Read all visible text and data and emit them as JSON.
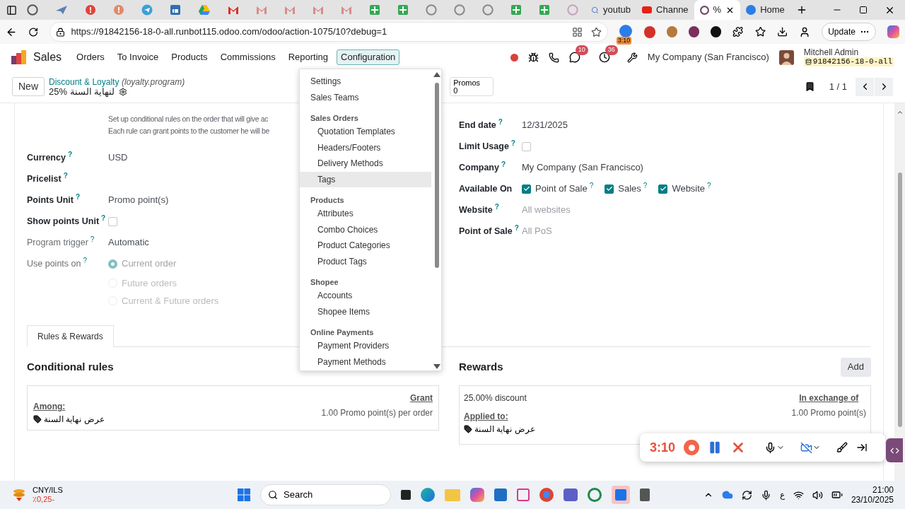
{
  "browser": {
    "tabs": [
      {
        "title": "youtub",
        "selected": false
      },
      {
        "title": "Channe",
        "selected": false
      },
      {
        "title": "%",
        "selected": true
      },
      {
        "title": "Home",
        "selected": false
      }
    ],
    "url": "https://91842156-18-0-all.runbot115.odoo.com/odoo/action-1075/10?debug=1",
    "extension_badge": "3:10",
    "update_button": "Update"
  },
  "navbar": {
    "app": "Sales",
    "menu": [
      {
        "label": "Orders",
        "selected": false
      },
      {
        "label": "To Invoice",
        "selected": false
      },
      {
        "label": "Products",
        "selected": false
      },
      {
        "label": "Commissions",
        "selected": false
      },
      {
        "label": "Reporting",
        "selected": false
      },
      {
        "label": "Configuration",
        "selected": true
      }
    ],
    "messages_count": "10",
    "activities_count": "36",
    "company": "My Company (San Francisco)",
    "user": {
      "name": "Mitchell Admin",
      "database": "91842156-18-0-all"
    }
  },
  "control_panel": {
    "new_button": "New",
    "breadcrumb": "Discount & Loyalty",
    "model": "(loyalty.program)",
    "record": "25% لنهاية السنة",
    "stat_button": {
      "label": "Promos",
      "value": "0"
    },
    "pager": "1 / 1"
  },
  "form": {
    "description": [
      "Set up conditional rules on the order that will give ac",
      "Each rule can grant points to the customer he will be"
    ],
    "left_fields": [
      {
        "label": "Currency",
        "help": "?",
        "kind": "text",
        "value": "USD",
        "disabled": false
      },
      {
        "label": "Pricelist",
        "help": "?",
        "kind": "empty",
        "disabled": false
      },
      {
        "label": "Points Unit",
        "help": "?",
        "kind": "text",
        "value": "Promo point(s)",
        "disabled": false
      },
      {
        "label": "Show points Unit",
        "help": "?",
        "kind": "checkbox",
        "checked": false,
        "disabled": false
      },
      {
        "label": "Program trigger",
        "help": "?",
        "kind": "text",
        "value": "Automatic",
        "disabled": true
      },
      {
        "label": "Use points on",
        "help": "?",
        "kind": "radio",
        "disabled": true,
        "options": [
          {
            "label": "Current order",
            "selected": true
          },
          {
            "label": "Future orders",
            "selected": false
          },
          {
            "label": "Current & Future orders",
            "selected": false
          }
        ]
      }
    ],
    "right_fields": [
      {
        "label": "End date",
        "help": "?",
        "kind": "text",
        "value": "12/31/2025"
      },
      {
        "label": "Limit Usage",
        "help": "?",
        "kind": "checkbox",
        "checked": false
      },
      {
        "label": "Company",
        "help": "?",
        "kind": "text",
        "value": "My Company (San Francisco)"
      },
      {
        "label": "Available On",
        "kind": "checks",
        "options": [
          {
            "label": "Point of Sale",
            "help": "?",
            "checked": true
          },
          {
            "label": "Sales",
            "help": "?",
            "checked": true
          },
          {
            "label": "Website",
            "help": "?",
            "checked": true
          }
        ]
      },
      {
        "label": "Website",
        "help": "?",
        "kind": "placeholder",
        "placeholder": "All websites"
      },
      {
        "label": "Point of Sale",
        "help": "?",
        "kind": "placeholder",
        "placeholder": "All PoS"
      }
    ],
    "tabs": [
      {
        "label": "Rules & Rewards",
        "selected": true
      }
    ],
    "rules": {
      "heading": "Conditional rules",
      "among_label": "Among:",
      "among_value": "عرض نهاية السنة",
      "grant_label": "Grant",
      "grant_value": "1.00 Promo point(s) per order"
    },
    "rewards": {
      "heading": "Rewards",
      "add_button": "Add",
      "discount": "25.00% discount",
      "applied_label": "Applied to:",
      "applied_value": "عرض نهاية السنة",
      "exchange_label": "In exchange of",
      "exchange_value": "1.00 Promo point(s)"
    }
  },
  "dropdown": [
    {
      "kind": "item",
      "label": "Settings",
      "hovered": false
    },
    {
      "kind": "item",
      "label": "Sales Teams",
      "hovered": false
    },
    {
      "kind": "heading",
      "label": "Sales Orders"
    },
    {
      "kind": "subitem",
      "label": "Quotation Templates",
      "hovered": false
    },
    {
      "kind": "subitem",
      "label": "Headers/Footers",
      "hovered": false
    },
    {
      "kind": "subitem",
      "label": "Delivery Methods",
      "hovered": false
    },
    {
      "kind": "subitem",
      "label": "Tags",
      "hovered": true
    },
    {
      "kind": "heading",
      "label": "Products"
    },
    {
      "kind": "subitem",
      "label": "Attributes",
      "hovered": false
    },
    {
      "kind": "subitem",
      "label": "Combo Choices",
      "hovered": false
    },
    {
      "kind": "subitem",
      "label": "Product Categories",
      "hovered": false
    },
    {
      "kind": "subitem",
      "label": "Product Tags",
      "hovered": false
    },
    {
      "kind": "heading",
      "label": "Shopee"
    },
    {
      "kind": "subitem",
      "label": "Accounts",
      "hovered": false
    },
    {
      "kind": "subitem",
      "label": "Shopee Items",
      "hovered": false
    },
    {
      "kind": "heading",
      "label": "Online Payments"
    },
    {
      "kind": "subitem",
      "label": "Payment Providers",
      "hovered": false
    },
    {
      "kind": "subitem",
      "label": "Payment Methods",
      "hovered": false
    }
  ],
  "recorder": {
    "time": "3:10"
  },
  "taskbar": {
    "widget_title": "CNY/ILS",
    "widget_change": "٪0,25-",
    "search": "Search",
    "language": "ع",
    "time": "21:00",
    "date": "23/10/2025"
  }
}
